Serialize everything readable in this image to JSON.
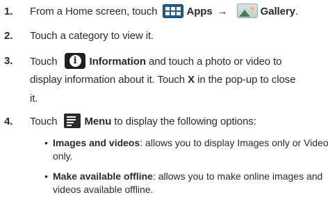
{
  "steps": [
    {
      "number": "1.",
      "prefix": "From a Home screen, touch",
      "apps_label": "Apps",
      "arrow": "→",
      "gallery_label": "Gallery",
      "suffix": "."
    },
    {
      "number": "2.",
      "text": "Touch a category to view it."
    },
    {
      "number": "3.",
      "touch": "Touch",
      "info_label": "Information",
      "line1_rest": "and touch a photo or video to",
      "line2": "display information about it. Touch",
      "close_key": "X",
      "line2_rest": "in the pop-up to close",
      "line3": "it."
    },
    {
      "number": "4.",
      "touch": "Touch",
      "menu_label": "Menu",
      "rest": "to display the following options:"
    }
  ],
  "options": [
    {
      "title": "Images and videos",
      "desc_line1": ": allows you to display Images only or Videos",
      "desc_line2": "only."
    },
    {
      "title": "Make available offline",
      "desc_line1": ": allows you to make online images and",
      "desc_line2": "videos available offline."
    }
  ],
  "icons": {
    "apps": "apps-grid-icon",
    "gallery": "gallery-icon",
    "information": "info-icon",
    "menu": "menu-icon"
  }
}
